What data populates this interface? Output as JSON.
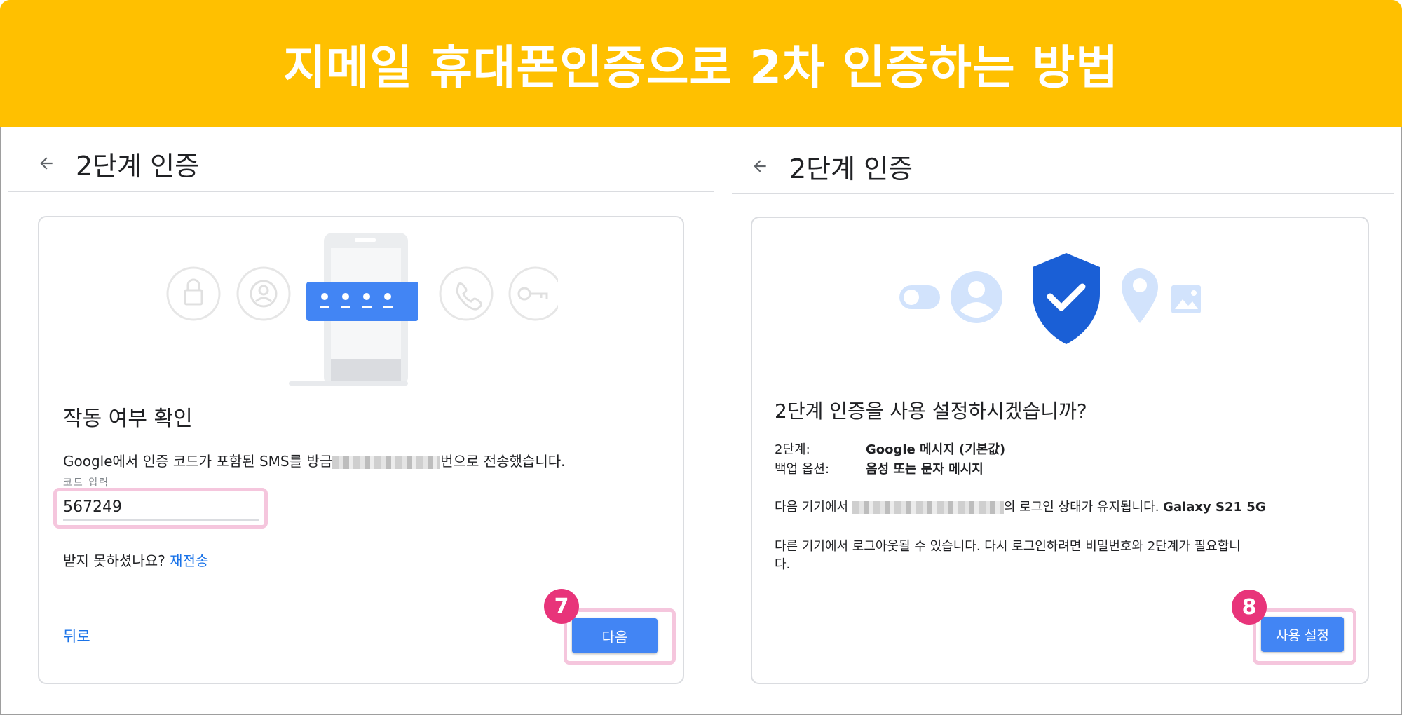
{
  "banner": {
    "title": "지메일 휴대폰인증으로 2차 인증하는 방법"
  },
  "left_panel": {
    "title": "2단계 인증",
    "heading": "작동 여부 확인",
    "sms_prefix": "Google에서 인증 코드가 포함된 SMS를 방금",
    "sms_suffix": "번으로 전송했습니다.",
    "code_label": "코드 입력",
    "code_value": "567249",
    "not_received": "받지 못하셨나요?",
    "resend": "재전송",
    "back": "뒤로",
    "next": "다음",
    "step": "7"
  },
  "right_panel": {
    "title": "2단계 인증",
    "heading": "2단계 인증을 사용 설정하시겠습니까?",
    "row1_label": "2단계:",
    "row1_value": "Google 메시지 (기본값)",
    "row2_label": "백업 옵션:",
    "row2_value": "음성 또는 문자 메시지",
    "device_suffix": "의 로그인 상태가 유지됩니다.",
    "device_name": "Galaxy S21 5G",
    "device_prefix": "다음 기기에서",
    "logout_line1": "다른 기기에서 로그아웃될 수 있습니다. 다시 로그인하려면 비밀번호와 2단계가 필요합니",
    "logout_line2": "다.",
    "enable": "사용 설정",
    "step": "8"
  },
  "colors": {
    "banner": "#FFC000",
    "accent_blue": "#4285F4",
    "link_blue": "#1a73e8",
    "highlight_pink": "#F5C6DD",
    "badge_pink": "#E8347A"
  }
}
